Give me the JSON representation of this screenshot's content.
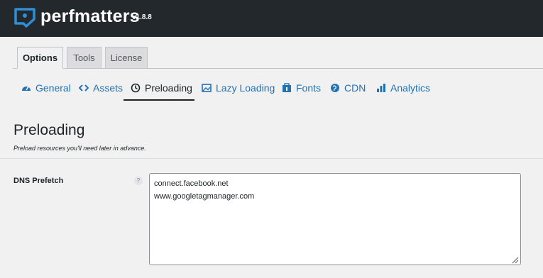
{
  "header": {
    "brand": "perfmatters",
    "version": "v1.8.8",
    "logo_icon": "perfmatters-logo-icon"
  },
  "tabs": [
    {
      "label": "Options",
      "active": true
    },
    {
      "label": "Tools",
      "active": false
    },
    {
      "label": "License",
      "active": false
    }
  ],
  "subnav": [
    {
      "label": "General",
      "icon": "dashboard-icon",
      "active": false
    },
    {
      "label": "Assets",
      "icon": "code-icon",
      "active": false
    },
    {
      "label": "Preloading",
      "icon": "clock-icon",
      "active": true
    },
    {
      "label": "Lazy Loading",
      "icon": "images-icon",
      "active": false
    },
    {
      "label": "Fonts",
      "icon": "fonts-icon",
      "active": false
    },
    {
      "label": "CDN",
      "icon": "globe-icon",
      "active": false
    },
    {
      "label": "Analytics",
      "icon": "chart-bar-icon",
      "active": false
    }
  ],
  "section": {
    "title": "Preloading",
    "description": "Preload resources you'll need later in advance."
  },
  "dns_prefetch": {
    "label": "DNS Prefetch",
    "help": "?",
    "value": "connect.facebook.net\nwww.googletagmanager.com"
  },
  "colors": {
    "header_bg": "#23282d",
    "link": "#2271b1",
    "page_bg": "#f1f1f1"
  }
}
